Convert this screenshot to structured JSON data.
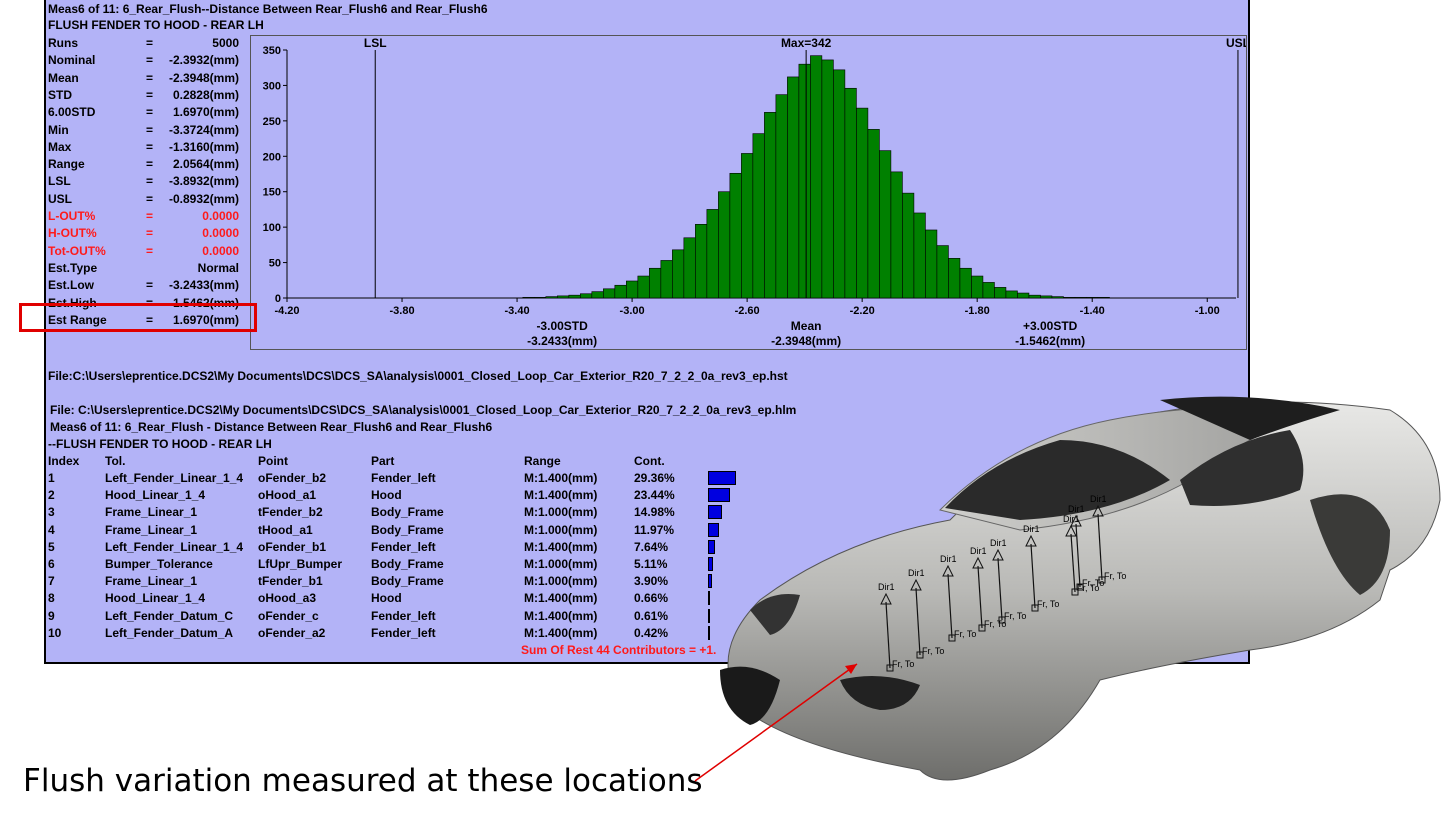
{
  "header": {
    "line1": "Meas6 of 11: 6_Rear_Flush--Distance Between Rear_Flush6 and Rear_Flush6",
    "line2": "FLUSH FENDER TO HOOD - REAR LH"
  },
  "stats": [
    {
      "name": "Runs",
      "eq": "=",
      "value": "5000",
      "red": false
    },
    {
      "name": "Nominal",
      "eq": "=",
      "value": "-2.3932(mm)",
      "red": false
    },
    {
      "name": "Mean",
      "eq": "=",
      "value": "-2.3948(mm)",
      "red": false
    },
    {
      "name": "STD",
      "eq": "=",
      "value": "0.2828(mm)",
      "red": false
    },
    {
      "name": "6.00STD",
      "eq": "=",
      "value": "1.6970(mm)",
      "red": false
    },
    {
      "name": "Min",
      "eq": "=",
      "value": "-3.3724(mm)",
      "red": false
    },
    {
      "name": "Max",
      "eq": "=",
      "value": "-1.3160(mm)",
      "red": false
    },
    {
      "name": "Range",
      "eq": "=",
      "value": "2.0564(mm)",
      "red": false
    },
    {
      "name": "LSL",
      "eq": "=",
      "value": "-3.8932(mm)",
      "red": false
    },
    {
      "name": "USL",
      "eq": "=",
      "value": "-0.8932(mm)",
      "red": false
    },
    {
      "name": "L-OUT%",
      "eq": "=",
      "value": "0.0000",
      "red": true
    },
    {
      "name": "H-OUT%",
      "eq": "=",
      "value": "0.0000",
      "red": true
    },
    {
      "name": "Tot-OUT%",
      "eq": "=",
      "value": "0.0000",
      "red": true
    },
    {
      "name": "Est.Type",
      "eq": "",
      "value": "Normal",
      "red": false
    },
    {
      "name": "Est.Low",
      "eq": "=",
      "value": "-3.2433(mm)",
      "red": false
    },
    {
      "name": "Est.High",
      "eq": "=",
      "value": "-1.5462(mm)",
      "red": false
    },
    {
      "name": "Est Range",
      "eq": "=",
      "value": "1.6970(mm)",
      "red": false
    }
  ],
  "chart_data": {
    "type": "bar",
    "bar_color": "#008000",
    "xlim": [
      -4.2,
      -0.9
    ],
    "ylim": [
      0,
      350
    ],
    "x_ticks": [
      "-4.20",
      "-3.80",
      "-3.40",
      "-3.00",
      "-2.60",
      "-2.20",
      "-1.80",
      "-1.40",
      "-1.00"
    ],
    "y_ticks": [
      "0",
      "50",
      "100",
      "150",
      "200",
      "250",
      "300",
      "350"
    ],
    "lsl": -3.8932,
    "usl": -0.8932,
    "mean": -2.3948,
    "lsl_label": "LSL",
    "usl_label": "USL",
    "max_label": "Max=342",
    "markers": [
      {
        "x": -3.2433,
        "label1": "-3.00STD",
        "label2": "-3.2433(mm)"
      },
      {
        "x": -2.3948,
        "label1": "Mean",
        "label2": "-2.3948(mm)"
      },
      {
        "x": -1.5462,
        "label1": "+3.00STD",
        "label2": "-1.5462(mm)"
      }
    ],
    "bin_width": 0.04,
    "bin_start": -3.38,
    "values": [
      1,
      1,
      2,
      3,
      4,
      6,
      9,
      13,
      18,
      24,
      31,
      42,
      53,
      68,
      85,
      104,
      125,
      150,
      176,
      204,
      232,
      262,
      287,
      312,
      330,
      342,
      336,
      322,
      296,
      268,
      238,
      208,
      178,
      148,
      120,
      96,
      74,
      56,
      42,
      31,
      22,
      15,
      10,
      7,
      4,
      3,
      2,
      1,
      1,
      1,
      1
    ]
  },
  "file_hst": "File:C:\\Users\\eprentice.DCS2\\My Documents\\DCS\\DCS_SA\\analysis\\0001_Closed_Loop_Car_Exterior_R20_7_2_2_0a_rev3_ep.hst",
  "file_hlm": "File: C:\\Users\\eprentice.DCS2\\My Documents\\DCS\\DCS_SA\\analysis\\0001_Closed_Loop_Car_Exterior_R20_7_2_2_0a_rev3_ep.hlm",
  "meas_line": "Meas6 of 11: 6_Rear_Flush - Distance Between Rear_Flush6 and Rear_Flush6",
  "meas_desc": "--FLUSH FENDER TO HOOD - REAR LH",
  "table": {
    "headers": [
      "Index",
      "Tol.",
      "Point",
      "Part",
      "Range",
      "Cont."
    ],
    "rows": [
      {
        "index": "1",
        "tol": "Left_Fender_Linear_1_4",
        "point": "oFender_b2",
        "part": "Fender_left",
        "range": "M:1.400(mm)",
        "cont": "29.36%",
        "pct": 29.36
      },
      {
        "index": "2",
        "tol": "Hood_Linear_1_4",
        "point": "oHood_a1",
        "part": "Hood",
        "range": "M:1.400(mm)",
        "cont": "23.44%",
        "pct": 23.44
      },
      {
        "index": "3",
        "tol": "Frame_Linear_1",
        "point": "tFender_b2",
        "part": "Body_Frame",
        "range": "M:1.000(mm)",
        "cont": "14.98%",
        "pct": 14.98
      },
      {
        "index": "4",
        "tol": "Frame_Linear_1",
        "point": "tHood_a1",
        "part": "Body_Frame",
        "range": "M:1.000(mm)",
        "cont": "11.97%",
        "pct": 11.97
      },
      {
        "index": "5",
        "tol": "Left_Fender_Linear_1_4",
        "point": "oFender_b1",
        "part": "Fender_left",
        "range": "M:1.400(mm)",
        "cont": "7.64%",
        "pct": 7.64
      },
      {
        "index": "6",
        "tol": "Bumper_Tolerance",
        "point": "LfUpr_Bumper",
        "part": "Body_Frame",
        "range": "M:1.000(mm)",
        "cont": "5.11%",
        "pct": 5.11
      },
      {
        "index": "7",
        "tol": "Frame_Linear_1",
        "point": "tFender_b1",
        "part": "Body_Frame",
        "range": "M:1.000(mm)",
        "cont": "3.90%",
        "pct": 3.9
      },
      {
        "index": "8",
        "tol": "Hood_Linear_1_4",
        "point": "oHood_a3",
        "part": "Hood",
        "range": "M:1.400(mm)",
        "cont": "0.66%",
        "pct": 0.66
      },
      {
        "index": "9",
        "tol": "Left_Fender_Datum_C",
        "point": "oFender_c",
        "part": "Fender_left",
        "range": "M:1.400(mm)",
        "cont": "0.61%",
        "pct": 0.61
      },
      {
        "index": "10",
        "tol": "Left_Fender_Datum_A",
        "point": "oFender_a2",
        "part": "Fender_left",
        "range": "M:1.400(mm)",
        "cont": "0.42%",
        "pct": 0.42
      }
    ],
    "sum_rest": "Sum Of Rest 44 Contributors = +1."
  },
  "car": {
    "dir_label": "Dir1",
    "fr_label": "Fr, To"
  },
  "caption": "Flush variation measured at these locations",
  "colors": {
    "panel": "#b3b3f7",
    "red": "#ff1a1a",
    "green": "#008000",
    "blue": "#0000e0",
    "arrow": "#e00000"
  }
}
